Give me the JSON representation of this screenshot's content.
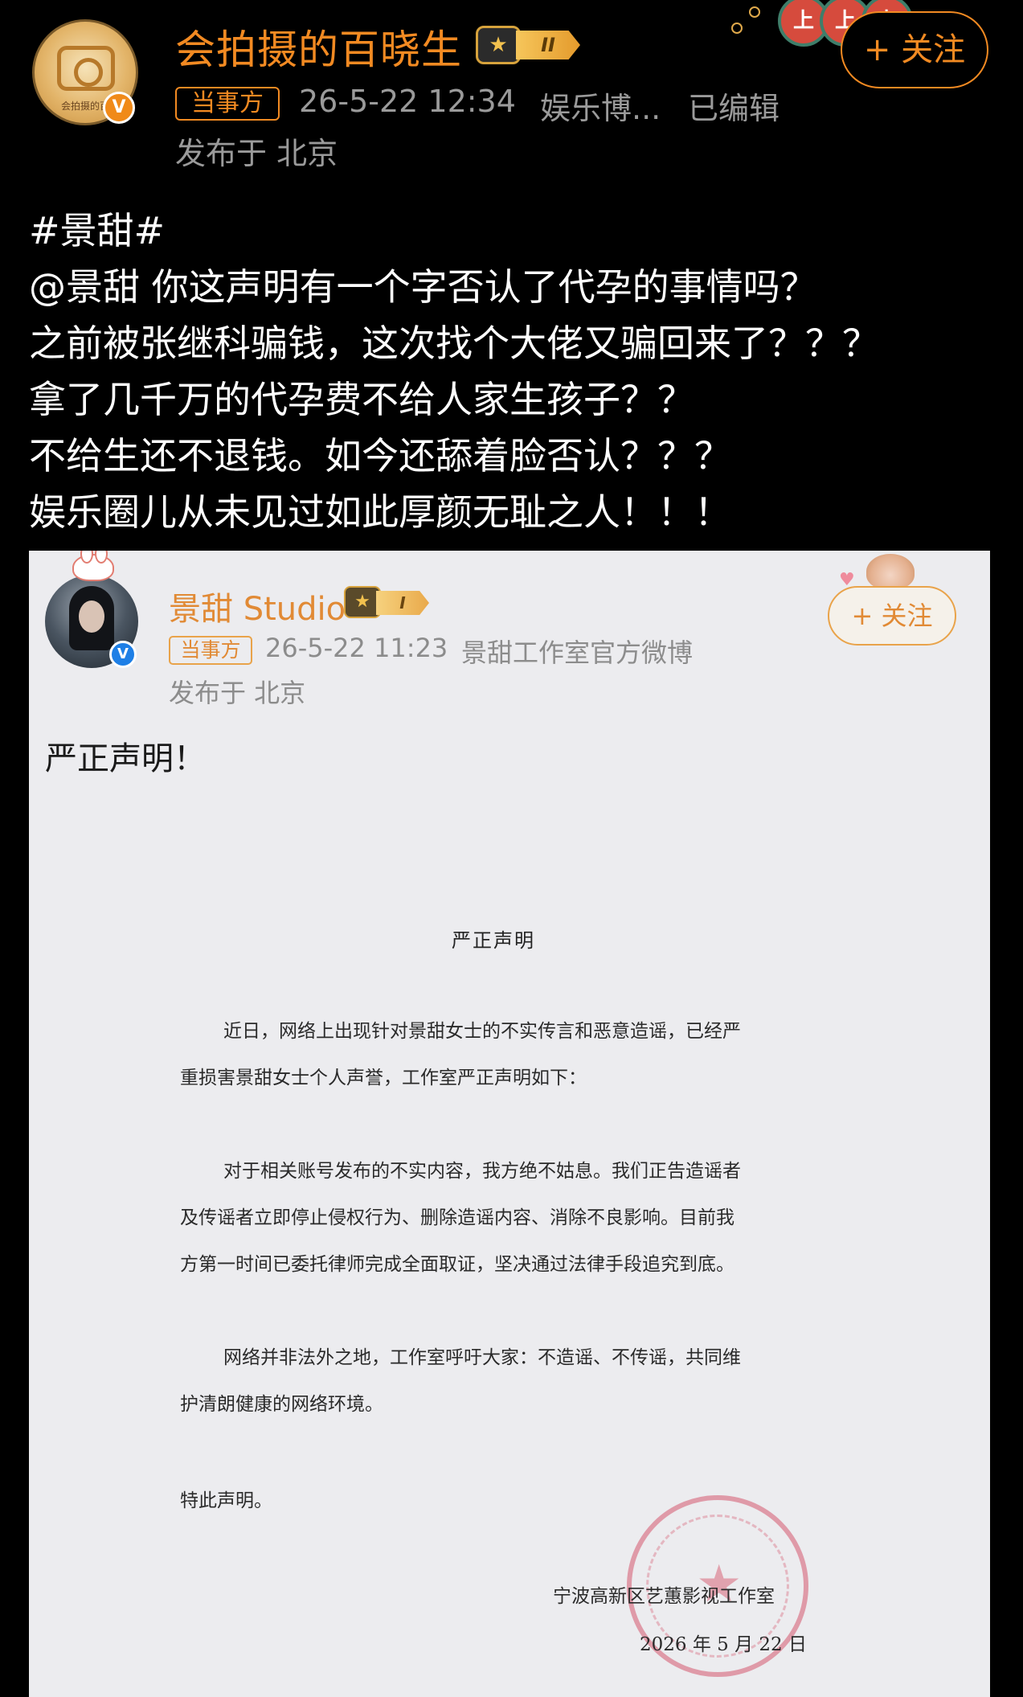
{
  "post": {
    "username": "会拍摄的百晓生",
    "level": "II",
    "avatar_text": "会拍摄的百",
    "follow_label": "+ 关注",
    "tag": "当事方",
    "time": "26-5-22 12:34",
    "source": "娱乐博...",
    "edited": "已编辑",
    "location": "发布于 北京",
    "lines": [
      "#景甜#",
      "@景甜 你这声明有一个字否认了代孕的事情吗？",
      "之前被张继科骗钱，这次找个大佬又骗回来了？？？",
      "拿了几千万的代孕费不给人家生孩子？？",
      "不给生还不退钱。如今还舔着脸否认？？？",
      "娱乐圈儿从未见过如此厚颜无耻之人！！！"
    ]
  },
  "embedded": {
    "username": "景甜 Studio",
    "level": "I",
    "follow_label": "+ 关注",
    "tag": "当事方",
    "time": "26-5-22 11:23",
    "source": "景甜工作室官方微博",
    "location": "发布于 北京",
    "text": "严正声明！",
    "document": {
      "title": "严正声明",
      "paragraphs": [
        [
          "近日，网络上出现针对景甜女士的不实传言和恶意造谣，已经严",
          "重损害景甜女士个人声誉，工作室严正声明如下："
        ],
        [
          "对于相关账号发布的不实内容，我方绝不姑息。我们正告造谣者",
          "及传谣者立即停止侵权行为、删除造谣内容、消除不良影响。目前我",
          "方第一时间已委托律师完成全面取证，坚决通过法律手段追究到底。"
        ],
        [
          "网络并非法外之地，工作室呼吁大家：不造谣、不传谣，共同维",
          "护清朗健康的网络环境。"
        ],
        [
          "特此声明。"
        ]
      ],
      "signature": "宁波高新区艺蕙影视工作室",
      "date": "2026 年 5 月 22 日"
    }
  },
  "colors": {
    "accent": "#f28a22",
    "background": "#000000",
    "meta": "#9a9a9a",
    "embed_background": "#ececef",
    "stamp": "#d6586e"
  }
}
